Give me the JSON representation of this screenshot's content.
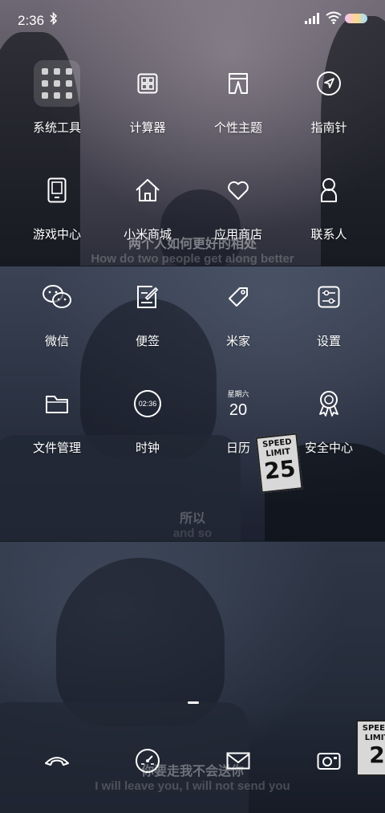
{
  "status_bar": {
    "time": "2:36"
  },
  "apps": [
    {
      "label": "系统工具"
    },
    {
      "label": "计算器"
    },
    {
      "label": "个性主题"
    },
    {
      "label": "指南针"
    },
    {
      "label": "游戏中心"
    },
    {
      "label": "小米商城"
    },
    {
      "label": "应用商店"
    },
    {
      "label": "联系人"
    },
    {
      "label": "微信"
    },
    {
      "label": "便签"
    },
    {
      "label": "米家"
    },
    {
      "label": "设置"
    },
    {
      "label": "文件管理"
    },
    {
      "label": "时钟",
      "icon_text": "02:36"
    },
    {
      "label": "日历",
      "weekday": "星期六",
      "day": "20"
    },
    {
      "label": "安全中心"
    }
  ],
  "dock": [
    {
      "icon": "phone-icon"
    },
    {
      "icon": "browser-compass-icon"
    },
    {
      "icon": "mail-icon"
    },
    {
      "icon": "camera-icon"
    }
  ],
  "wallpaper": {
    "lyric1_cn": "两个人如何更好的相处",
    "lyric1_en": "How do two people get along better",
    "lyric2_cn": "所以",
    "lyric2_en": "and so",
    "lyric3_cn": "你要走我不会送你",
    "lyric3_en": "I will leave you, I will not send you",
    "sign_text1": "SPEED",
    "sign_text2": "LIMIT",
    "sign_number": "25",
    "sign2_text1": "SPEED",
    "sign2_text2": "LIMIT",
    "sign2_number": "2"
  }
}
